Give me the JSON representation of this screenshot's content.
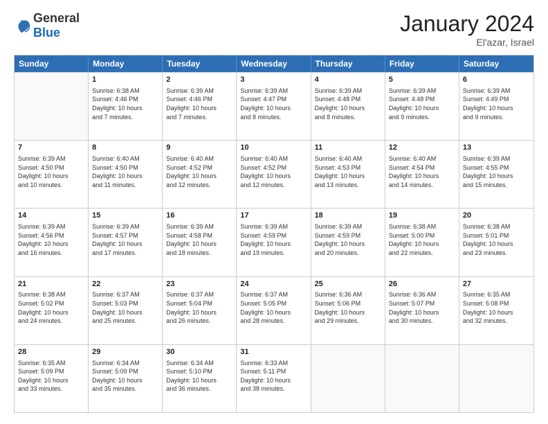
{
  "header": {
    "logo_general": "General",
    "logo_blue": "Blue",
    "month": "January 2024",
    "location": "El'azar, Israel"
  },
  "days_of_week": [
    "Sunday",
    "Monday",
    "Tuesday",
    "Wednesday",
    "Thursday",
    "Friday",
    "Saturday"
  ],
  "weeks": [
    [
      {
        "day": "",
        "info": ""
      },
      {
        "day": "1",
        "info": "Sunrise: 6:38 AM\nSunset: 4:46 PM\nDaylight: 10 hours\nand 7 minutes."
      },
      {
        "day": "2",
        "info": "Sunrise: 6:39 AM\nSunset: 4:46 PM\nDaylight: 10 hours\nand 7 minutes."
      },
      {
        "day": "3",
        "info": "Sunrise: 6:39 AM\nSunset: 4:47 PM\nDaylight: 10 hours\nand 8 minutes."
      },
      {
        "day": "4",
        "info": "Sunrise: 6:39 AM\nSunset: 4:48 PM\nDaylight: 10 hours\nand 8 minutes."
      },
      {
        "day": "5",
        "info": "Sunrise: 6:39 AM\nSunset: 4:48 PM\nDaylight: 10 hours\nand 9 minutes."
      },
      {
        "day": "6",
        "info": "Sunrise: 6:39 AM\nSunset: 4:49 PM\nDaylight: 10 hours\nand 9 minutes."
      }
    ],
    [
      {
        "day": "7",
        "info": ""
      },
      {
        "day": "8",
        "info": "Sunrise: 6:40 AM\nSunset: 4:50 PM\nDaylight: 10 hours\nand 11 minutes."
      },
      {
        "day": "9",
        "info": "Sunrise: 6:40 AM\nSunset: 4:52 PM\nDaylight: 10 hours\nand 12 minutes."
      },
      {
        "day": "10",
        "info": "Sunrise: 6:40 AM\nSunset: 4:52 PM\nDaylight: 10 hours\nand 12 minutes."
      },
      {
        "day": "11",
        "info": "Sunrise: 6:40 AM\nSunset: 4:53 PM\nDaylight: 10 hours\nand 13 minutes."
      },
      {
        "day": "12",
        "info": "Sunrise: 6:40 AM\nSunset: 4:54 PM\nDaylight: 10 hours\nand 14 minutes."
      },
      {
        "day": "13",
        "info": "Sunrise: 6:39 AM\nSunset: 4:55 PM\nDaylight: 10 hours\nand 15 minutes."
      }
    ],
    [
      {
        "day": "14",
        "info": "Sunrise: 6:39 AM\nSunset: 4:56 PM\nDaylight: 10 hours\nand 16 minutes."
      },
      {
        "day": "15",
        "info": "Sunrise: 6:39 AM\nSunset: 4:57 PM\nDaylight: 10 hours\nand 17 minutes."
      },
      {
        "day": "16",
        "info": "Sunrise: 6:39 AM\nSunset: 4:58 PM\nDaylight: 10 hours\nand 18 minutes."
      },
      {
        "day": "17",
        "info": "Sunrise: 6:39 AM\nSunset: 4:59 PM\nDaylight: 10 hours\nand 19 minutes."
      },
      {
        "day": "18",
        "info": "Sunrise: 6:39 AM\nSunset: 4:59 PM\nDaylight: 10 hours\nand 20 minutes."
      },
      {
        "day": "19",
        "info": "Sunrise: 6:38 AM\nSunset: 5:00 PM\nDaylight: 10 hours\nand 22 minutes."
      },
      {
        "day": "20",
        "info": "Sunrise: 6:38 AM\nSunset: 5:01 PM\nDaylight: 10 hours\nand 23 minutes."
      }
    ],
    [
      {
        "day": "21",
        "info": "Sunrise: 6:38 AM\nSunset: 5:02 PM\nDaylight: 10 hours\nand 24 minutes."
      },
      {
        "day": "22",
        "info": "Sunrise: 6:37 AM\nSunset: 5:03 PM\nDaylight: 10 hours\nand 25 minutes."
      },
      {
        "day": "23",
        "info": "Sunrise: 6:37 AM\nSunset: 5:04 PM\nDaylight: 10 hours\nand 26 minutes."
      },
      {
        "day": "24",
        "info": "Sunrise: 6:37 AM\nSunset: 5:05 PM\nDaylight: 10 hours\nand 28 minutes."
      },
      {
        "day": "25",
        "info": "Sunrise: 6:36 AM\nSunset: 5:06 PM\nDaylight: 10 hours\nand 29 minutes."
      },
      {
        "day": "26",
        "info": "Sunrise: 6:36 AM\nSunset: 5:07 PM\nDaylight: 10 hours\nand 30 minutes."
      },
      {
        "day": "27",
        "info": "Sunrise: 6:35 AM\nSunset: 5:08 PM\nDaylight: 10 hours\nand 32 minutes."
      }
    ],
    [
      {
        "day": "28",
        "info": "Sunrise: 6:35 AM\nSunset: 5:09 PM\nDaylight: 10 hours\nand 33 minutes."
      },
      {
        "day": "29",
        "info": "Sunrise: 6:34 AM\nSunset: 5:09 PM\nDaylight: 10 hours\nand 35 minutes."
      },
      {
        "day": "30",
        "info": "Sunrise: 6:34 AM\nSunset: 5:10 PM\nDaylight: 10 hours\nand 36 minutes."
      },
      {
        "day": "31",
        "info": "Sunrise: 6:33 AM\nSunset: 5:11 PM\nDaylight: 10 hours\nand 38 minutes."
      },
      {
        "day": "",
        "info": ""
      },
      {
        "day": "",
        "info": ""
      },
      {
        "day": "",
        "info": ""
      }
    ]
  ],
  "week7_sunday_info": "Sunrise: 6:39 AM\nSunset: 4:50 PM\nDaylight: 10 hours\nand 10 minutes."
}
